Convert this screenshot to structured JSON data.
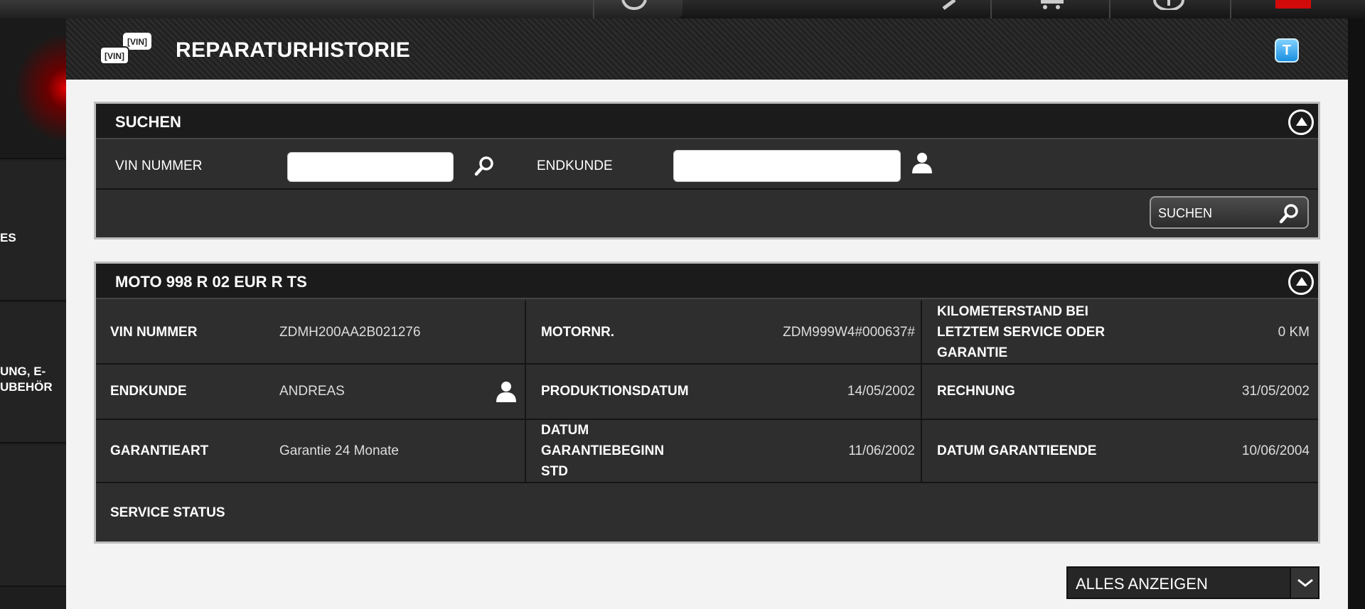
{
  "header": {
    "title": "REPARATURHISTORIE",
    "logo_text": "VIN",
    "badge": "T"
  },
  "sidebar": {
    "items": [
      {
        "label": ""
      },
      {
        "label": "ES"
      },
      {
        "label": "UNG, E-\nUBEHÖR"
      },
      {
        "label": ""
      }
    ]
  },
  "search_panel": {
    "title": "SUCHEN",
    "vin_label": "VIN NUMMER",
    "vin_value": "",
    "customer_label": "ENDKUNDE",
    "customer_value": "",
    "search_button": "SUCHEN"
  },
  "vehicle_panel": {
    "title": "MOTO 998 R 02 EUR R TS",
    "vin_label": "VIN NUMMER",
    "vin_value": "ZDMH200AA2B021276",
    "engine_label": "MOTORNR.",
    "engine_value": "ZDM999W4#000637#",
    "mileage_label_1": "KILOMETERSTAND BEI",
    "mileage_label_2": "LETZTEM SERVICE ODER",
    "mileage_label_3": "GARANTIE",
    "mileage_value": "0 KM",
    "customer_label": "ENDKUNDE",
    "customer_value": "ANDREAS",
    "production_label": "PRODUKTIONSDATUM",
    "production_value": "14/05/2002",
    "invoice_label": "RECHNUNG",
    "invoice_value": "31/05/2002",
    "warranty_type_label": "GARANTIEART",
    "warranty_type_value": "Garantie 24 Monate",
    "warranty_start_label_1": "DATUM",
    "warranty_start_label_2": "GARANTIEBEGINN",
    "warranty_start_label_3": "STD",
    "warranty_start_value": "11/06/2002",
    "warranty_end_label": "DATUM GARANTIEENDE",
    "warranty_end_value": "10/06/2004",
    "service_status_label": "SERVICE STATUS",
    "service_status_value": ""
  },
  "show_all": {
    "label": "ALLES ANZEIGEN"
  },
  "colors": {
    "accent_red": "#d30a0a",
    "badge_blue": "#1a8fe0"
  }
}
